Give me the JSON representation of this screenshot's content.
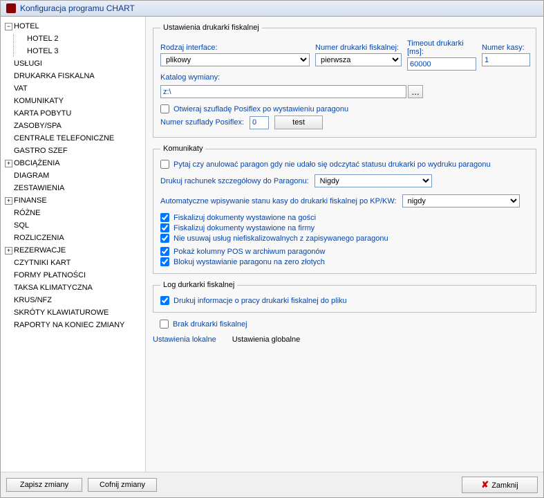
{
  "window": {
    "title": "Konfiguracja programu CHART"
  },
  "tree": [
    {
      "label": "HOTEL",
      "expanded": true,
      "children": [
        {
          "label": "HOTEL 2"
        },
        {
          "label": "HOTEL 3"
        }
      ]
    },
    {
      "label": "USŁUGI"
    },
    {
      "label": "DRUKARKA FISKALNA"
    },
    {
      "label": "VAT"
    },
    {
      "label": "KOMUNIKATY"
    },
    {
      "label": "KARTA POBYTU"
    },
    {
      "label": "ZASOBY/SPA"
    },
    {
      "label": "CENTRALE TELEFONICZNE"
    },
    {
      "label": "GASTRO SZEF"
    },
    {
      "label": "OBCIĄŻENIA",
      "expandable": true
    },
    {
      "label": "DIAGRAM"
    },
    {
      "label": "ZESTAWIENIA"
    },
    {
      "label": "FINANSE",
      "expandable": true
    },
    {
      "label": "RÓŻNE"
    },
    {
      "label": "SQL"
    },
    {
      "label": "ROZLICZENIA"
    },
    {
      "label": "REZERWACJE",
      "expandable": true
    },
    {
      "label": "CZYTNIKI KART"
    },
    {
      "label": "FORMY PŁATNOŚCI"
    },
    {
      "label": "TAKSA KLIMATYCZNA"
    },
    {
      "label": "KRUS/NFZ"
    },
    {
      "label": "SKRÓTY KLAWIATUROWE"
    },
    {
      "label": "RAPORTY NA KONIEC ZMIANY"
    }
  ],
  "fiscal": {
    "legend": "Ustawienia drukarki fiskalnej",
    "iface_label": "Rodzaj interface:",
    "iface_value": "plikowy",
    "num_label": "Numer drukarki fiskalnej:",
    "num_value": "pierwsza",
    "timeout_label": "Timeout drukarki [ms]:",
    "timeout_value": "60000",
    "kasa_label": "Numer kasy:",
    "kasa_value": "1",
    "katalog_label": "Katalog wymiany:",
    "katalog_value": "z:\\",
    "browse": "...",
    "posiflex_open": "Otwieraj szufladę Posiflex po wystawieniu paragonu",
    "posiflex_num_label": "Numer szuflady Posiflex:",
    "posiflex_num_value": "0",
    "test_btn": "test"
  },
  "komunikaty": {
    "legend": "Komunikaty",
    "ask_cancel": "Pytaj czy anulować paragon gdy nie udało się odczytać statusu drukarki po wydruku paragonu",
    "detail_label": "Drukuj rachunek szczegółowy do Paragonu:",
    "detail_value": "Nigdy",
    "auto_label": "Automatyczne wpisywanie stanu kasy do drukarki fiskalnej po KP/KW:",
    "auto_value": "nigdy",
    "fisk_guests": "Fiskalizuj dokumenty wystawione na gości",
    "fisk_firms": "Fiskalizuj dokumenty wystawione na firmy",
    "no_remove": "Nie usuwaj usług niefiskalizowalnych z zapisywanego paragonu",
    "show_pos": "Pokaż kolumny POS w archiwum paragonów",
    "block_zero": "Blokuj wystawianie paragonu na zero złotych"
  },
  "log": {
    "legend": "Log durkarki fiskalnej",
    "print_info": "Drukuj informacje o pracy drukarki fiskalnej do pliku"
  },
  "no_printer": "Brak drukarki fiskalnej",
  "tabs": {
    "local": "Ustawienia lokalne",
    "global": "Ustawienia globalne"
  },
  "footer": {
    "save": "Zapisz zmiany",
    "undo": "Cofnij zmiany",
    "close": "Zamknij"
  }
}
